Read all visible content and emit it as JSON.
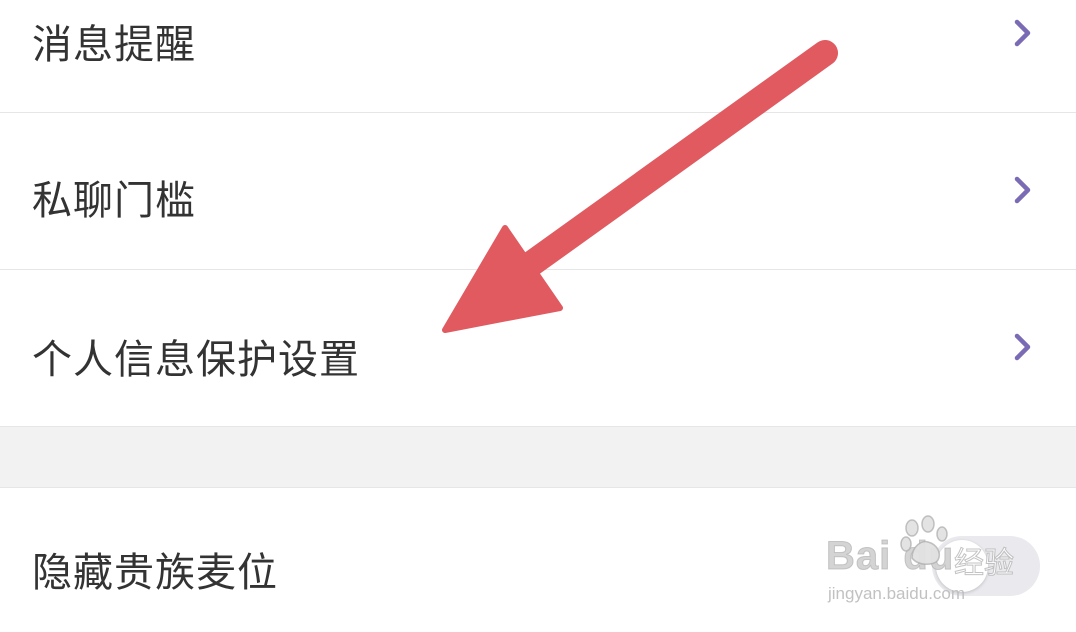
{
  "settings": {
    "items": [
      {
        "label": "消息提醒",
        "icon": "chevron-right-icon"
      },
      {
        "label": "私聊门槛",
        "icon": "chevron-right-icon"
      },
      {
        "label": "个人信息保护设置",
        "icon": "chevron-right-icon"
      },
      {
        "label": "隐藏贵族麦位",
        "control": "toggle",
        "toggle_on": false
      }
    ]
  },
  "annotation": {
    "type": "arrow",
    "color": "#e05a60",
    "points_to": "个人信息保护设置"
  },
  "watermark": {
    "main": "Bai du",
    "cn": "经验",
    "url": "jingyan.baidu.com"
  },
  "colors": {
    "chevron": "#7b6bb5",
    "text": "#333333",
    "divider": "#e6e6e6",
    "section_gap": "#f2f2f2",
    "toggle_off": "#e9e9ee"
  }
}
